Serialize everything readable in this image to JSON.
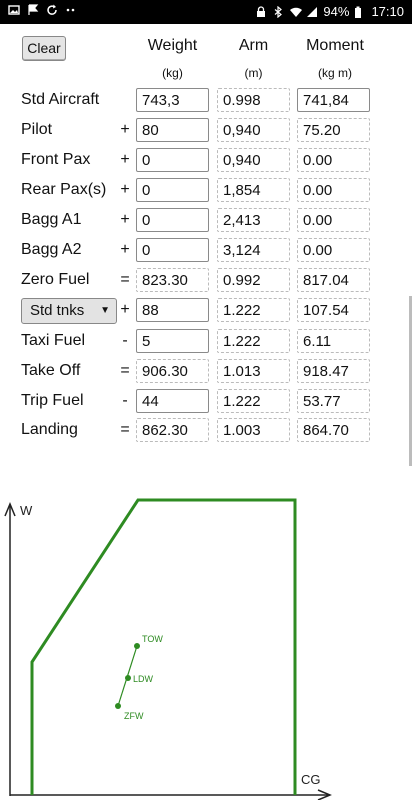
{
  "status_bar": {
    "battery": "94%",
    "time": "17:10",
    "left_icons": [
      "image-icon",
      "flag-icon",
      "sync-icon",
      "more-dots-icon"
    ],
    "right_icons": [
      "lock-icon",
      "bluetooth-icon",
      "wifi-icon",
      "signal-icon",
      "battery-icon"
    ]
  },
  "clear_label": "Clear",
  "columns": {
    "weight": "Weight",
    "arm": "Arm",
    "moment": "Moment",
    "weight_unit": "(kg)",
    "arm_unit": "(m)",
    "moment_unit": "(kg m)"
  },
  "rows": [
    {
      "label": "Std Aircraft",
      "op": "",
      "weight": "743,3",
      "arm": "0.998",
      "moment": "741,84"
    },
    {
      "label": "Pilot",
      "op": "+",
      "weight": "80",
      "arm": "0,940",
      "moment": "75.20"
    },
    {
      "label": "Front Pax",
      "op": "+",
      "weight": "0",
      "arm": "0,940",
      "moment": "0.00"
    },
    {
      "label": "Rear Pax(s)",
      "op": "+",
      "weight": "0",
      "arm": "1,854",
      "moment": "0.00"
    },
    {
      "label": "Bagg A1",
      "op": "+",
      "weight": "0",
      "arm": "2,413",
      "moment": "0.00"
    },
    {
      "label": "Bagg A2",
      "op": "+",
      "weight": "0",
      "arm": "3,124",
      "moment": "0.00"
    },
    {
      "label": "Zero Fuel",
      "op": "=",
      "weight": "823.30",
      "arm": "0.992",
      "moment": "817.04"
    },
    {
      "label": "Std tnks",
      "op": "+",
      "weight": "88",
      "arm": "1.222",
      "moment": "107.54"
    },
    {
      "label": "Taxi Fuel",
      "op": "-",
      "weight": "5",
      "arm": "1.222",
      "moment": "6.11"
    },
    {
      "label": "Take Off",
      "op": "=",
      "weight": "906.30",
      "arm": "1.013",
      "moment": "918.47"
    },
    {
      "label": "Trip Fuel",
      "op": "-",
      "weight": "44",
      "arm": "1.222",
      "moment": "53.77"
    },
    {
      "label": "Landing",
      "op": "=",
      "weight": "862.30",
      "arm": "1.003",
      "moment": "864.70"
    }
  ],
  "envelope": {
    "y_axis_label": "W",
    "x_axis_label": "CG",
    "points": [
      {
        "label": "TOW",
        "cg": 1.013,
        "weight": 906.3
      },
      {
        "label": "LDW",
        "cg": 1.003,
        "weight": 862.3
      },
      {
        "label": "ZFW",
        "cg": 0.992,
        "weight": 823.3
      }
    ],
    "colors": {
      "envelope": "#2e8b22",
      "axes": "#222222"
    }
  }
}
